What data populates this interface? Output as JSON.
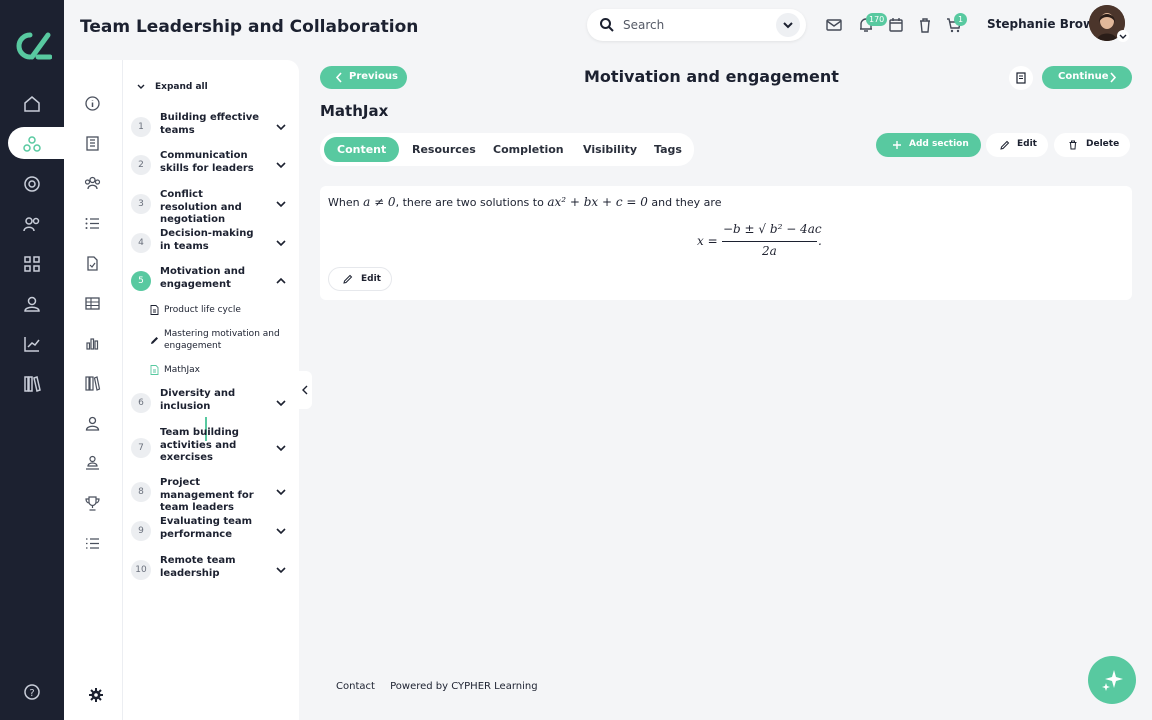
{
  "header": {
    "title": "Team Leadership and Collaboration",
    "search_placeholder": "Search",
    "notifications_count": "170",
    "cart_count": "1",
    "user_name": "Stephanie Brown"
  },
  "sidebar": {
    "expand_all": "Expand all",
    "modules": [
      {
        "num": "1",
        "title": "Building effective teams"
      },
      {
        "num": "2",
        "title": "Communication skills for leaders"
      },
      {
        "num": "3",
        "title": "Conflict resolution and negotiation"
      },
      {
        "num": "4",
        "title": "Decision-making in teams"
      },
      {
        "num": "5",
        "title": "Motivation and engagement"
      },
      {
        "num": "6",
        "title": "Diversity and inclusion"
      },
      {
        "num": "7",
        "title": "Team building activities and exercises"
      },
      {
        "num": "8",
        "title": "Project management for team leaders"
      },
      {
        "num": "9",
        "title": "Evaluating team performance"
      },
      {
        "num": "10",
        "title": "Remote team leadership"
      }
    ],
    "sub_items": [
      {
        "label": "Product life cycle"
      },
      {
        "label": "Mastering motivation and engagement"
      },
      {
        "label": "MathJax"
      }
    ]
  },
  "main": {
    "previous_label": "Previous",
    "continue_label": "Continue",
    "title": "Motivation and engagement",
    "section_title": "MathJax",
    "tabs": [
      "Content",
      "Resources",
      "Completion",
      "Visibility",
      "Tags"
    ],
    "add_section_label": "Add section",
    "edit_label": "Edit",
    "delete_label": "Delete",
    "content": {
      "text_when": "When",
      "cond": "a ≠ 0",
      "text_mid": ", there are two solutions to",
      "equation": "ax² + bx + c = 0",
      "text_end": "and they are",
      "lhs": "x =",
      "numerator": "−b ± √ b² − 4ac",
      "denominator": "2a",
      "period": "."
    },
    "card_edit_label": "Edit"
  },
  "footer": {
    "contact": "Contact",
    "powered": "Powered by CYPHER Learning"
  },
  "colors": {
    "accent": "#58c9a0",
    "rail": "#1c2130"
  }
}
